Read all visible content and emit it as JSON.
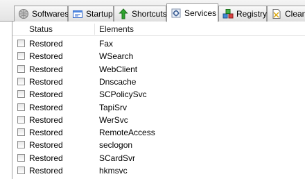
{
  "tabs": [
    {
      "label": "Softwares",
      "icon": "globe-icon"
    },
    {
      "label": "Startup",
      "icon": "startup-window-icon"
    },
    {
      "label": "Shortcuts",
      "icon": "green-arrow-icon"
    },
    {
      "label": "Services",
      "icon": "services-gear-icon",
      "active": true
    },
    {
      "label": "Registry",
      "icon": "registry-cubes-icon"
    },
    {
      "label": "Clean",
      "icon": "clean-document-icon"
    }
  ],
  "table": {
    "columns": [
      "Status",
      "Elements"
    ],
    "rows": [
      {
        "status": "Restored",
        "element": "Fax"
      },
      {
        "status": "Restored",
        "element": "WSearch"
      },
      {
        "status": "Restored",
        "element": "WebClient"
      },
      {
        "status": "Restored",
        "element": "Dnscache"
      },
      {
        "status": "Restored",
        "element": "SCPolicySvc"
      },
      {
        "status": "Restored",
        "element": "TapiSrv"
      },
      {
        "status": "Restored",
        "element": "WerSvc"
      },
      {
        "status": "Restored",
        "element": "RemoteAccess"
      },
      {
        "status": "Restored",
        "element": "seclogon"
      },
      {
        "status": "Restored",
        "element": "SCardSvr"
      },
      {
        "status": "Restored",
        "element": "hkmsvc"
      }
    ]
  }
}
